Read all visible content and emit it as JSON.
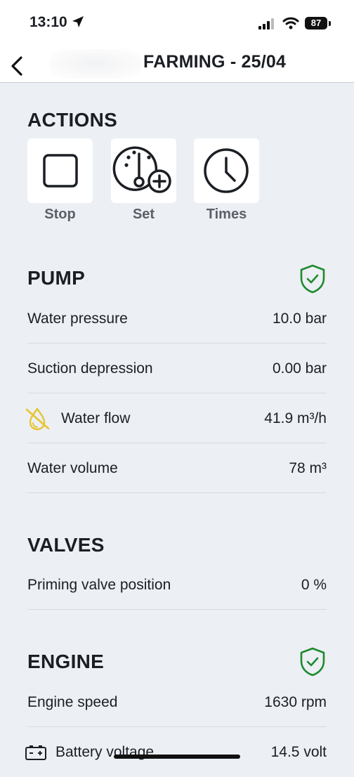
{
  "status_bar": {
    "time": "13:10",
    "battery": "87"
  },
  "nav": {
    "title": "FARMING - 25/04",
    "back_icon": "chevron-left-icon"
  },
  "actions": {
    "title": "ACTIONS",
    "items": [
      {
        "label": "Stop",
        "icon": "stop-square-icon"
      },
      {
        "label": "Set",
        "icon": "gauge-plus-icon"
      },
      {
        "label": "Times",
        "icon": "clock-icon"
      }
    ]
  },
  "pump": {
    "title": "PUMP",
    "status_icon": "shield-check-icon",
    "status_color": "#1e8a2e",
    "rows": [
      {
        "label": "Water pressure",
        "value": "10.0 bar"
      },
      {
        "label": "Suction depression",
        "value": "0.00 bar"
      },
      {
        "label": "Water flow",
        "value": "41.9 m³/h",
        "icon": "water-drop-off-icon",
        "icon_color": "#e6c531"
      },
      {
        "label": "Water volume",
        "value": "78 m³"
      }
    ]
  },
  "valves": {
    "title": "VALVES",
    "rows": [
      {
        "label": "Priming valve position",
        "value": "0 %"
      }
    ]
  },
  "engine": {
    "title": "ENGINE",
    "status_icon": "shield-check-icon",
    "rows": [
      {
        "label": "Engine speed",
        "value": "1630 rpm"
      },
      {
        "label": "Battery voltage",
        "value": "14.5 volt",
        "icon": "battery-icon"
      }
    ]
  }
}
